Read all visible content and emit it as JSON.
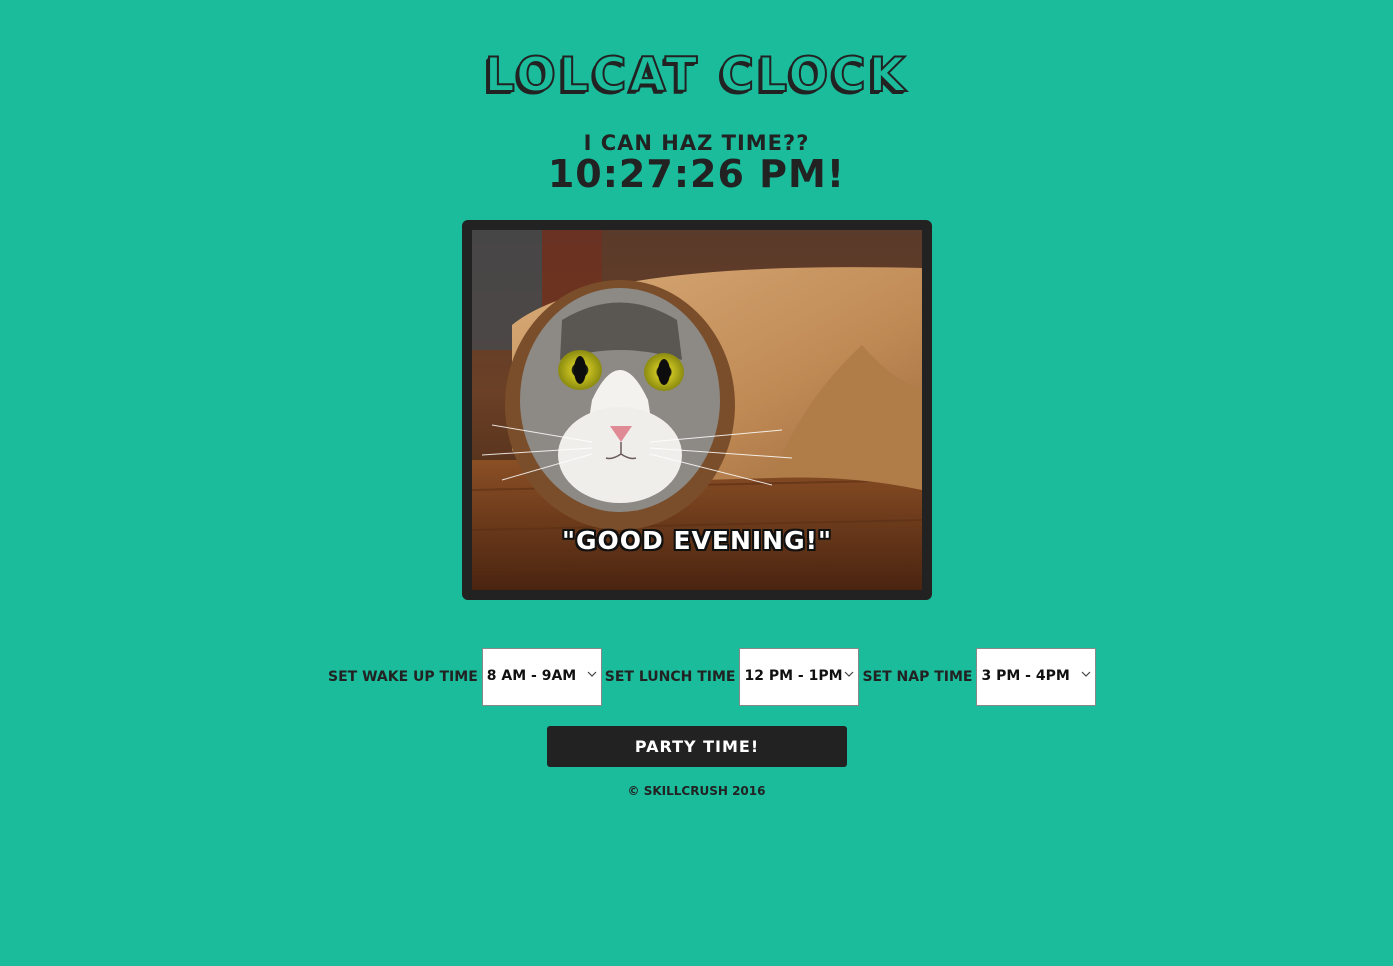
{
  "app": {
    "title": "LOLCAT CLOCK"
  },
  "clock": {
    "label": "I CAN HAZ TIME??",
    "time": "10:27:26 PM!"
  },
  "image": {
    "caption": "\"GOOD EVENING!\""
  },
  "controls": {
    "wakeup": {
      "label": "SET WAKE UP TIME",
      "selected": "8 AM - 9AM"
    },
    "lunch": {
      "label": "SET LUNCH TIME",
      "selected": "12 PM - 1PM"
    },
    "nap": {
      "label": "SET NAP TIME",
      "selected": "3 PM - 4PM"
    }
  },
  "party_button": {
    "label": "PARTY TIME!"
  },
  "footer": {
    "text": "© SKILLCRUSH 2016"
  },
  "colors": {
    "background": "#1abc9c",
    "dark": "#222222",
    "white": "#ffffff"
  }
}
